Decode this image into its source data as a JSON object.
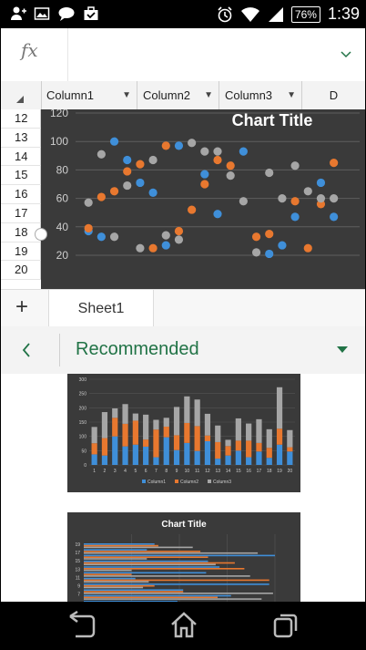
{
  "status": {
    "battery": "76%",
    "time": "1:39",
    "icons": [
      "add-person-icon",
      "image-icon",
      "chat-bubble-icon",
      "briefcase-check-icon",
      "alarm-icon",
      "wifi-icon",
      "signal-icon",
      "battery-icon"
    ]
  },
  "formula_bar": {
    "fx": "fx"
  },
  "columns": [
    {
      "label": "Column1",
      "filter": true
    },
    {
      "label": "Column2",
      "filter": true
    },
    {
      "label": "Column3",
      "filter": true
    },
    {
      "label": "D",
      "filter": false
    }
  ],
  "rows": [
    "12",
    "13",
    "14",
    "15",
    "16",
    "17",
    "18",
    "19",
    "20"
  ],
  "sheet": {
    "add": "+",
    "tab": "Sheet1"
  },
  "recommended": {
    "label": "Recommended"
  },
  "colors": {
    "accent": "#217346",
    "blue": "#3f8fd9",
    "orange": "#e8782f",
    "gray": "#a6a6a6",
    "chart_bg": "#3a3a3a"
  },
  "chart_data": [
    {
      "type": "scatter",
      "title": "Chart Title",
      "yticks": [
        "20",
        "40",
        "60",
        "80",
        "100",
        "120"
      ],
      "ylim": [
        20,
        120
      ],
      "xlim": [
        0,
        22
      ],
      "grid": true,
      "series": [
        {
          "color": "#3f8fd9",
          "points": [
            [
              1,
              37
            ],
            [
              2,
              33
            ],
            [
              3,
              100
            ],
            [
              4,
              87
            ],
            [
              5,
              71
            ],
            [
              6,
              64
            ],
            [
              7,
              27
            ],
            [
              8,
              97
            ],
            [
              10,
              77
            ],
            [
              11,
              49
            ],
            [
              13,
              93
            ],
            [
              15,
              21
            ],
            [
              16,
              27
            ],
            [
              17,
              47
            ],
            [
              19,
              71
            ],
            [
              20,
              47
            ]
          ]
        },
        {
          "color": "#e8782f",
          "points": [
            [
              1,
              39
            ],
            [
              2,
              61
            ],
            [
              3,
              65
            ],
            [
              4,
              79
            ],
            [
              5,
              84
            ],
            [
              6,
              25
            ],
            [
              7,
              97
            ],
            [
              8,
              37
            ],
            [
              9,
              52
            ],
            [
              10,
              70
            ],
            [
              11,
              87
            ],
            [
              12,
              83
            ],
            [
              14,
              33
            ],
            [
              15,
              35
            ],
            [
              17,
              58
            ],
            [
              18,
              25
            ],
            [
              19,
              56
            ],
            [
              20,
              85
            ]
          ]
        },
        {
          "color": "#a6a6a6",
          "points": [
            [
              1,
              57
            ],
            [
              2,
              91
            ],
            [
              3,
              33
            ],
            [
              4,
              69
            ],
            [
              5,
              25
            ],
            [
              6,
              87
            ],
            [
              7,
              34
            ],
            [
              8,
              31
            ],
            [
              9,
              99
            ],
            [
              10,
              93
            ],
            [
              11,
              93
            ],
            [
              12,
              76
            ],
            [
              13,
              58
            ],
            [
              14,
              22
            ],
            [
              15,
              78
            ],
            [
              16,
              60
            ],
            [
              17,
              83
            ],
            [
              18,
              65
            ],
            [
              19,
              60
            ],
            [
              20,
              60
            ]
          ]
        }
      ]
    },
    {
      "type": "bar",
      "stacked": true,
      "yticks": [
        "0",
        "50",
        "100",
        "150",
        "200",
        "250",
        "300"
      ],
      "ylim": [
        0,
        300
      ],
      "categories": [
        "1",
        "2",
        "3",
        "4",
        "5",
        "6",
        "7",
        "8",
        "9",
        "10",
        "11",
        "12",
        "13",
        "14",
        "15",
        "16",
        "17",
        "18",
        "19",
        "20"
      ],
      "legend": [
        "Column1",
        "Column2",
        "Column3"
      ],
      "series": [
        {
          "name": "Column1",
          "color": "#3f8fd9",
          "values": [
            37,
            33,
            100,
            65,
            71,
            64,
            27,
            97,
            52,
            77,
            49,
            83,
            22,
            33,
            50,
            27,
            47,
            25,
            71,
            47
          ]
        },
        {
          "name": "Column2",
          "color": "#e8782f",
          "values": [
            39,
            61,
            65,
            79,
            84,
            25,
            97,
            37,
            52,
            70,
            87,
            20,
            58,
            33,
            35,
            58,
            30,
            35,
            56,
            15
          ]
        },
        {
          "name": "Column3",
          "color": "#a6a6a6",
          "values": [
            57,
            91,
            33,
            69,
            25,
            87,
            34,
            31,
            99,
            93,
            93,
            76,
            58,
            22,
            78,
            60,
            83,
            65,
            145,
            60
          ]
        }
      ]
    },
    {
      "type": "bar",
      "orientation": "horizontal",
      "title": "Chart Title",
      "categories": [
        "19",
        "17",
        "15",
        "13",
        "11",
        "9",
        "7"
      ],
      "series": [
        {
          "color": "#3f8fd9",
          "values": [
            37,
            33,
            100,
            65,
            71,
            64,
            27,
            97,
            52,
            77,
            49,
            83,
            22
          ]
        },
        {
          "color": "#e8782f",
          "values": [
            39,
            61,
            65,
            79,
            84,
            25,
            97,
            37,
            52,
            70,
            87,
            20,
            58
          ]
        },
        {
          "color": "#a6a6a6",
          "values": [
            57,
            91,
            33,
            69,
            25,
            87,
            34,
            31,
            99,
            93,
            93,
            76,
            58
          ]
        }
      ]
    }
  ]
}
